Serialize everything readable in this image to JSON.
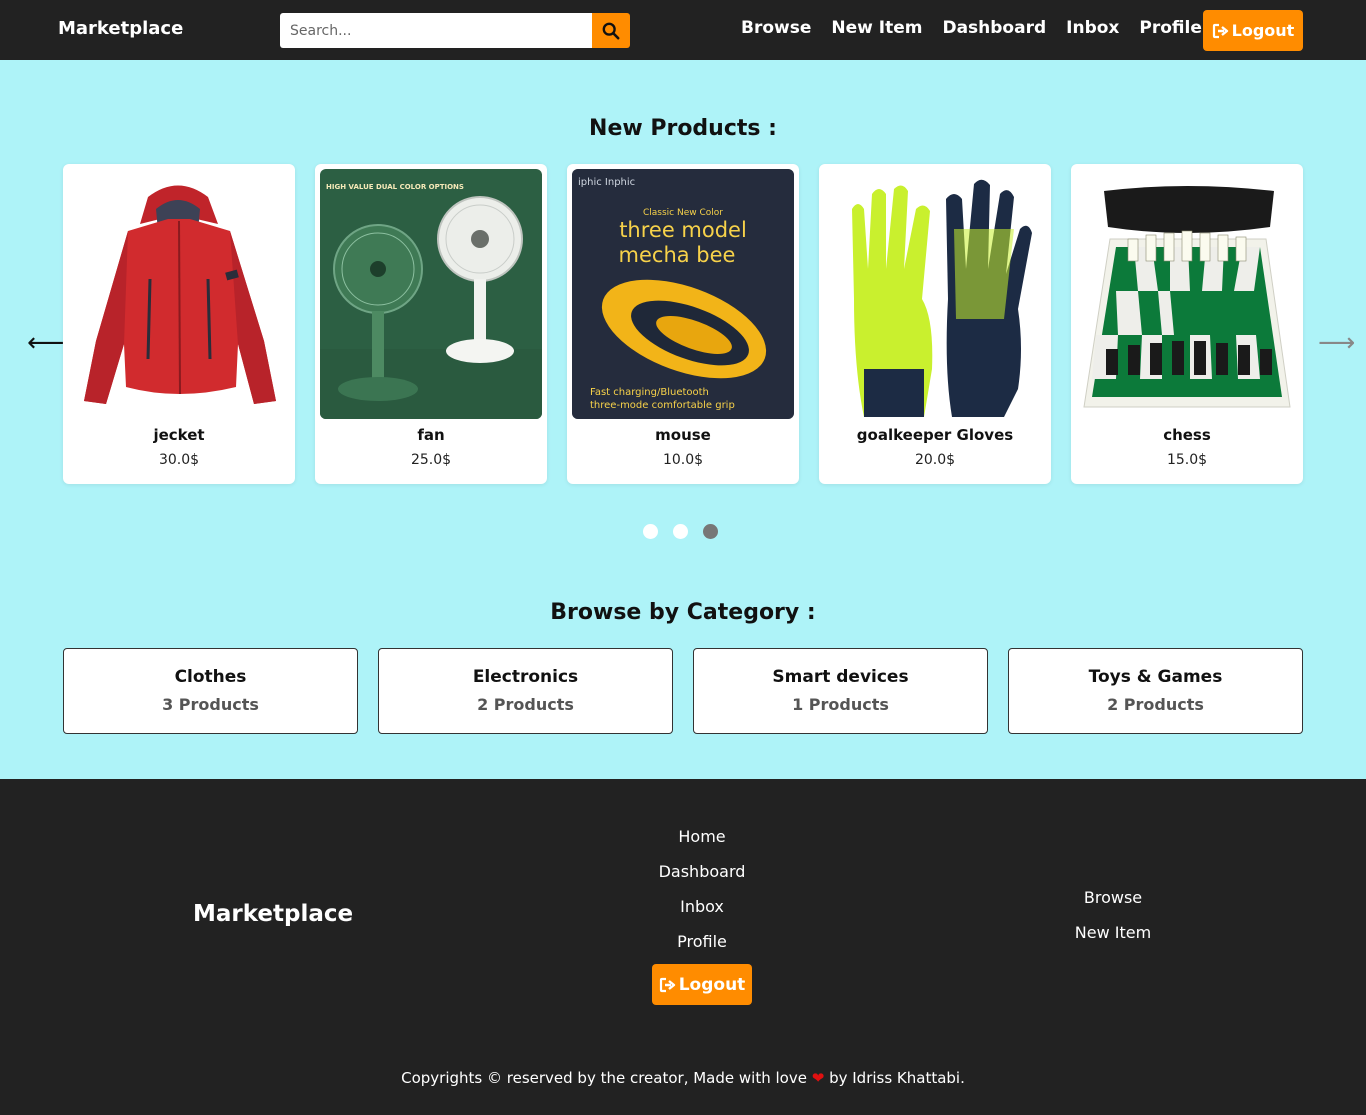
{
  "navbar": {
    "brand": "Marketplace",
    "search_placeholder": "Search...",
    "links": [
      "Browse",
      "New Item",
      "Dashboard",
      "Inbox",
      "Profile"
    ],
    "logout_label": "Logout"
  },
  "new_products": {
    "title": "New Products :",
    "items": [
      {
        "name": "jecket",
        "price": "30.0$",
        "image": "red-jacket-photo"
      },
      {
        "name": "fan",
        "price": "25.0$",
        "image": "fan-photo",
        "image_text": [
          "HIGH VALUE DUAL COLOR OPTIONS"
        ]
      },
      {
        "name": "mouse",
        "price": "10.0$",
        "image": "gaming-mouse-photo",
        "image_text": [
          "iphic Inphic",
          "Classic New Color",
          "three model",
          "mecha bee",
          "Fast charging/Bluetooth",
          "three-mode comfortable grip"
        ]
      },
      {
        "name": "goalkeeper Gloves",
        "price": "20.0$",
        "image": "goalkeeper-gloves-photo"
      },
      {
        "name": "chess",
        "price": "15.0$",
        "image": "chess-set-photo"
      }
    ],
    "dots": 3,
    "active_dot": 3
  },
  "categories": {
    "title": "Browse by Category :",
    "items": [
      {
        "name": "Clothes",
        "count": "3 Products"
      },
      {
        "name": "Electronics",
        "count": "2 Products"
      },
      {
        "name": "Smart devices",
        "count": "1 Products"
      },
      {
        "name": "Toys & Games",
        "count": "2 Products"
      }
    ]
  },
  "footer": {
    "brand": "Marketplace",
    "col1": [
      "Home",
      "Dashboard",
      "Inbox",
      "Profile"
    ],
    "logout_label": "Logout",
    "col2": [
      "Browse",
      "New Item"
    ],
    "copyright_before": "Copyrights © reserved by the creator, Made with love",
    "copyright_after": "by Idriss Khattabi."
  },
  "colors": {
    "accent": "#ff8c00",
    "nav_bg": "#222222",
    "page_bg": "#aef3f8"
  }
}
